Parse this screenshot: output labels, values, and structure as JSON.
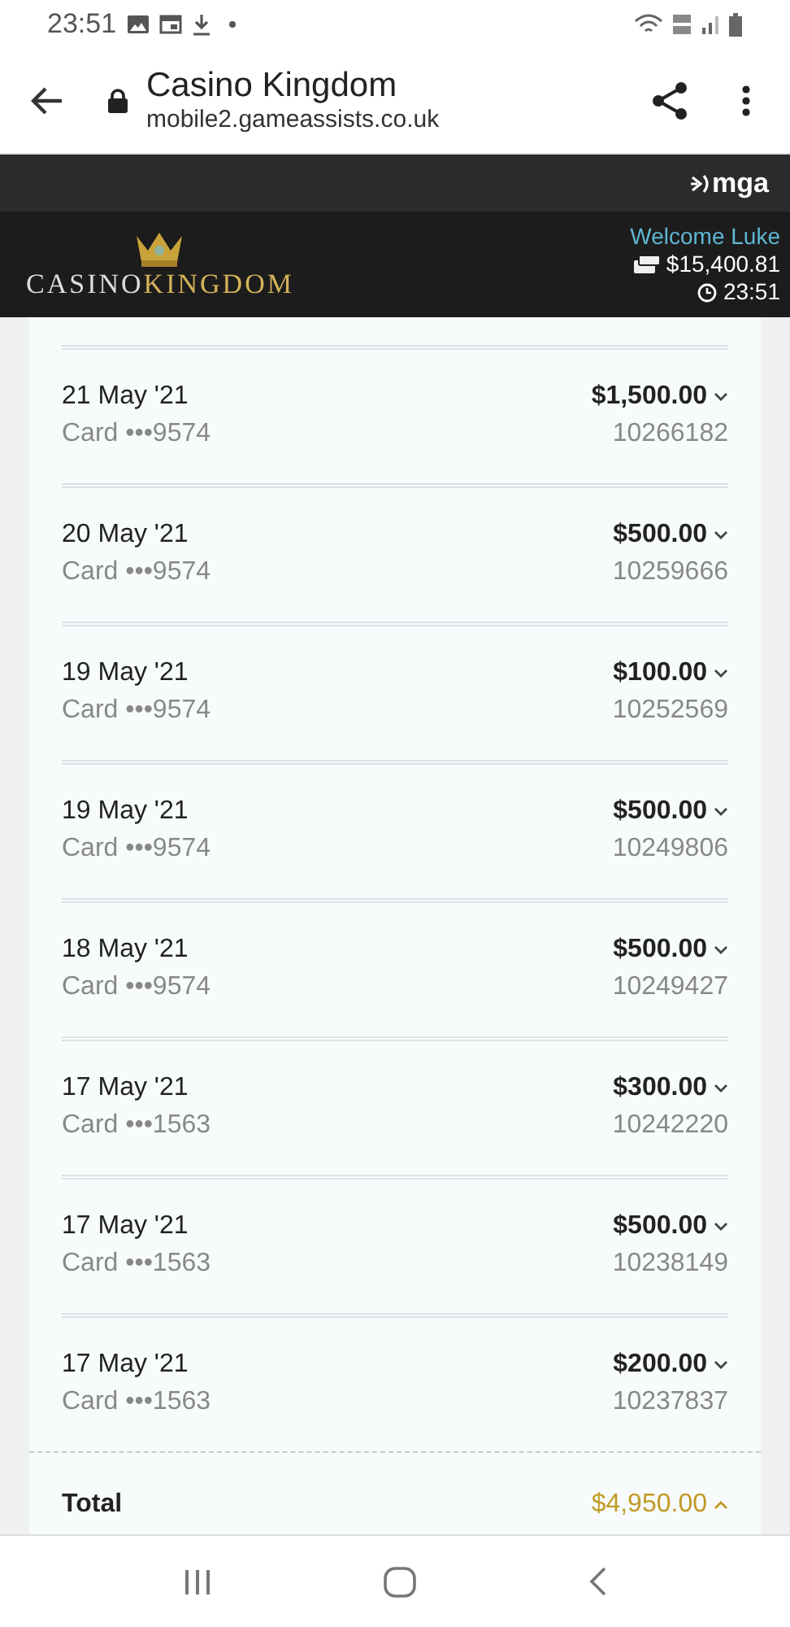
{
  "status_bar": {
    "time": "23:51"
  },
  "browser": {
    "title": "Casino Kingdom",
    "url": "mobile2.gameassists.co.uk"
  },
  "regulator": {
    "label": "mga"
  },
  "header": {
    "logo": [
      "CASINO",
      "KINGDOM"
    ],
    "welcome": "Welcome Luke",
    "balance": "$15,400.81",
    "clock": "23:51"
  },
  "transactions": [
    {
      "date": "21 May '21",
      "method": "Card •••9574",
      "amount": "$1,500.00",
      "reference": "10266182",
      "expanded": false
    },
    {
      "date": "20 May '21",
      "method": "Card •••9574",
      "amount": "$500.00",
      "reference": "10259666",
      "expanded": false
    },
    {
      "date": "19 May '21",
      "method": "Card •••9574",
      "amount": "$100.00",
      "reference": "10252569",
      "expanded": false
    },
    {
      "date": "19 May '21",
      "method": "Card •••9574",
      "amount": "$500.00",
      "reference": "10249806",
      "expanded": false
    },
    {
      "date": "18 May '21",
      "method": "Card •••9574",
      "amount": "$500.00",
      "reference": "10249427",
      "expanded": false
    },
    {
      "date": "17 May '21",
      "method": "Card •••1563",
      "amount": "$300.00",
      "reference": "10242220",
      "expanded": false
    },
    {
      "date": "17 May '21",
      "method": "Card •••1563",
      "amount": "$500.00",
      "reference": "10238149",
      "expanded": false
    },
    {
      "date": "17 May '21",
      "method": "Card •••1563",
      "amount": "$200.00",
      "reference": "10237837",
      "expanded": false
    }
  ],
  "total": {
    "label": "Total",
    "amount": "$4,950.00",
    "expanded": true
  }
}
